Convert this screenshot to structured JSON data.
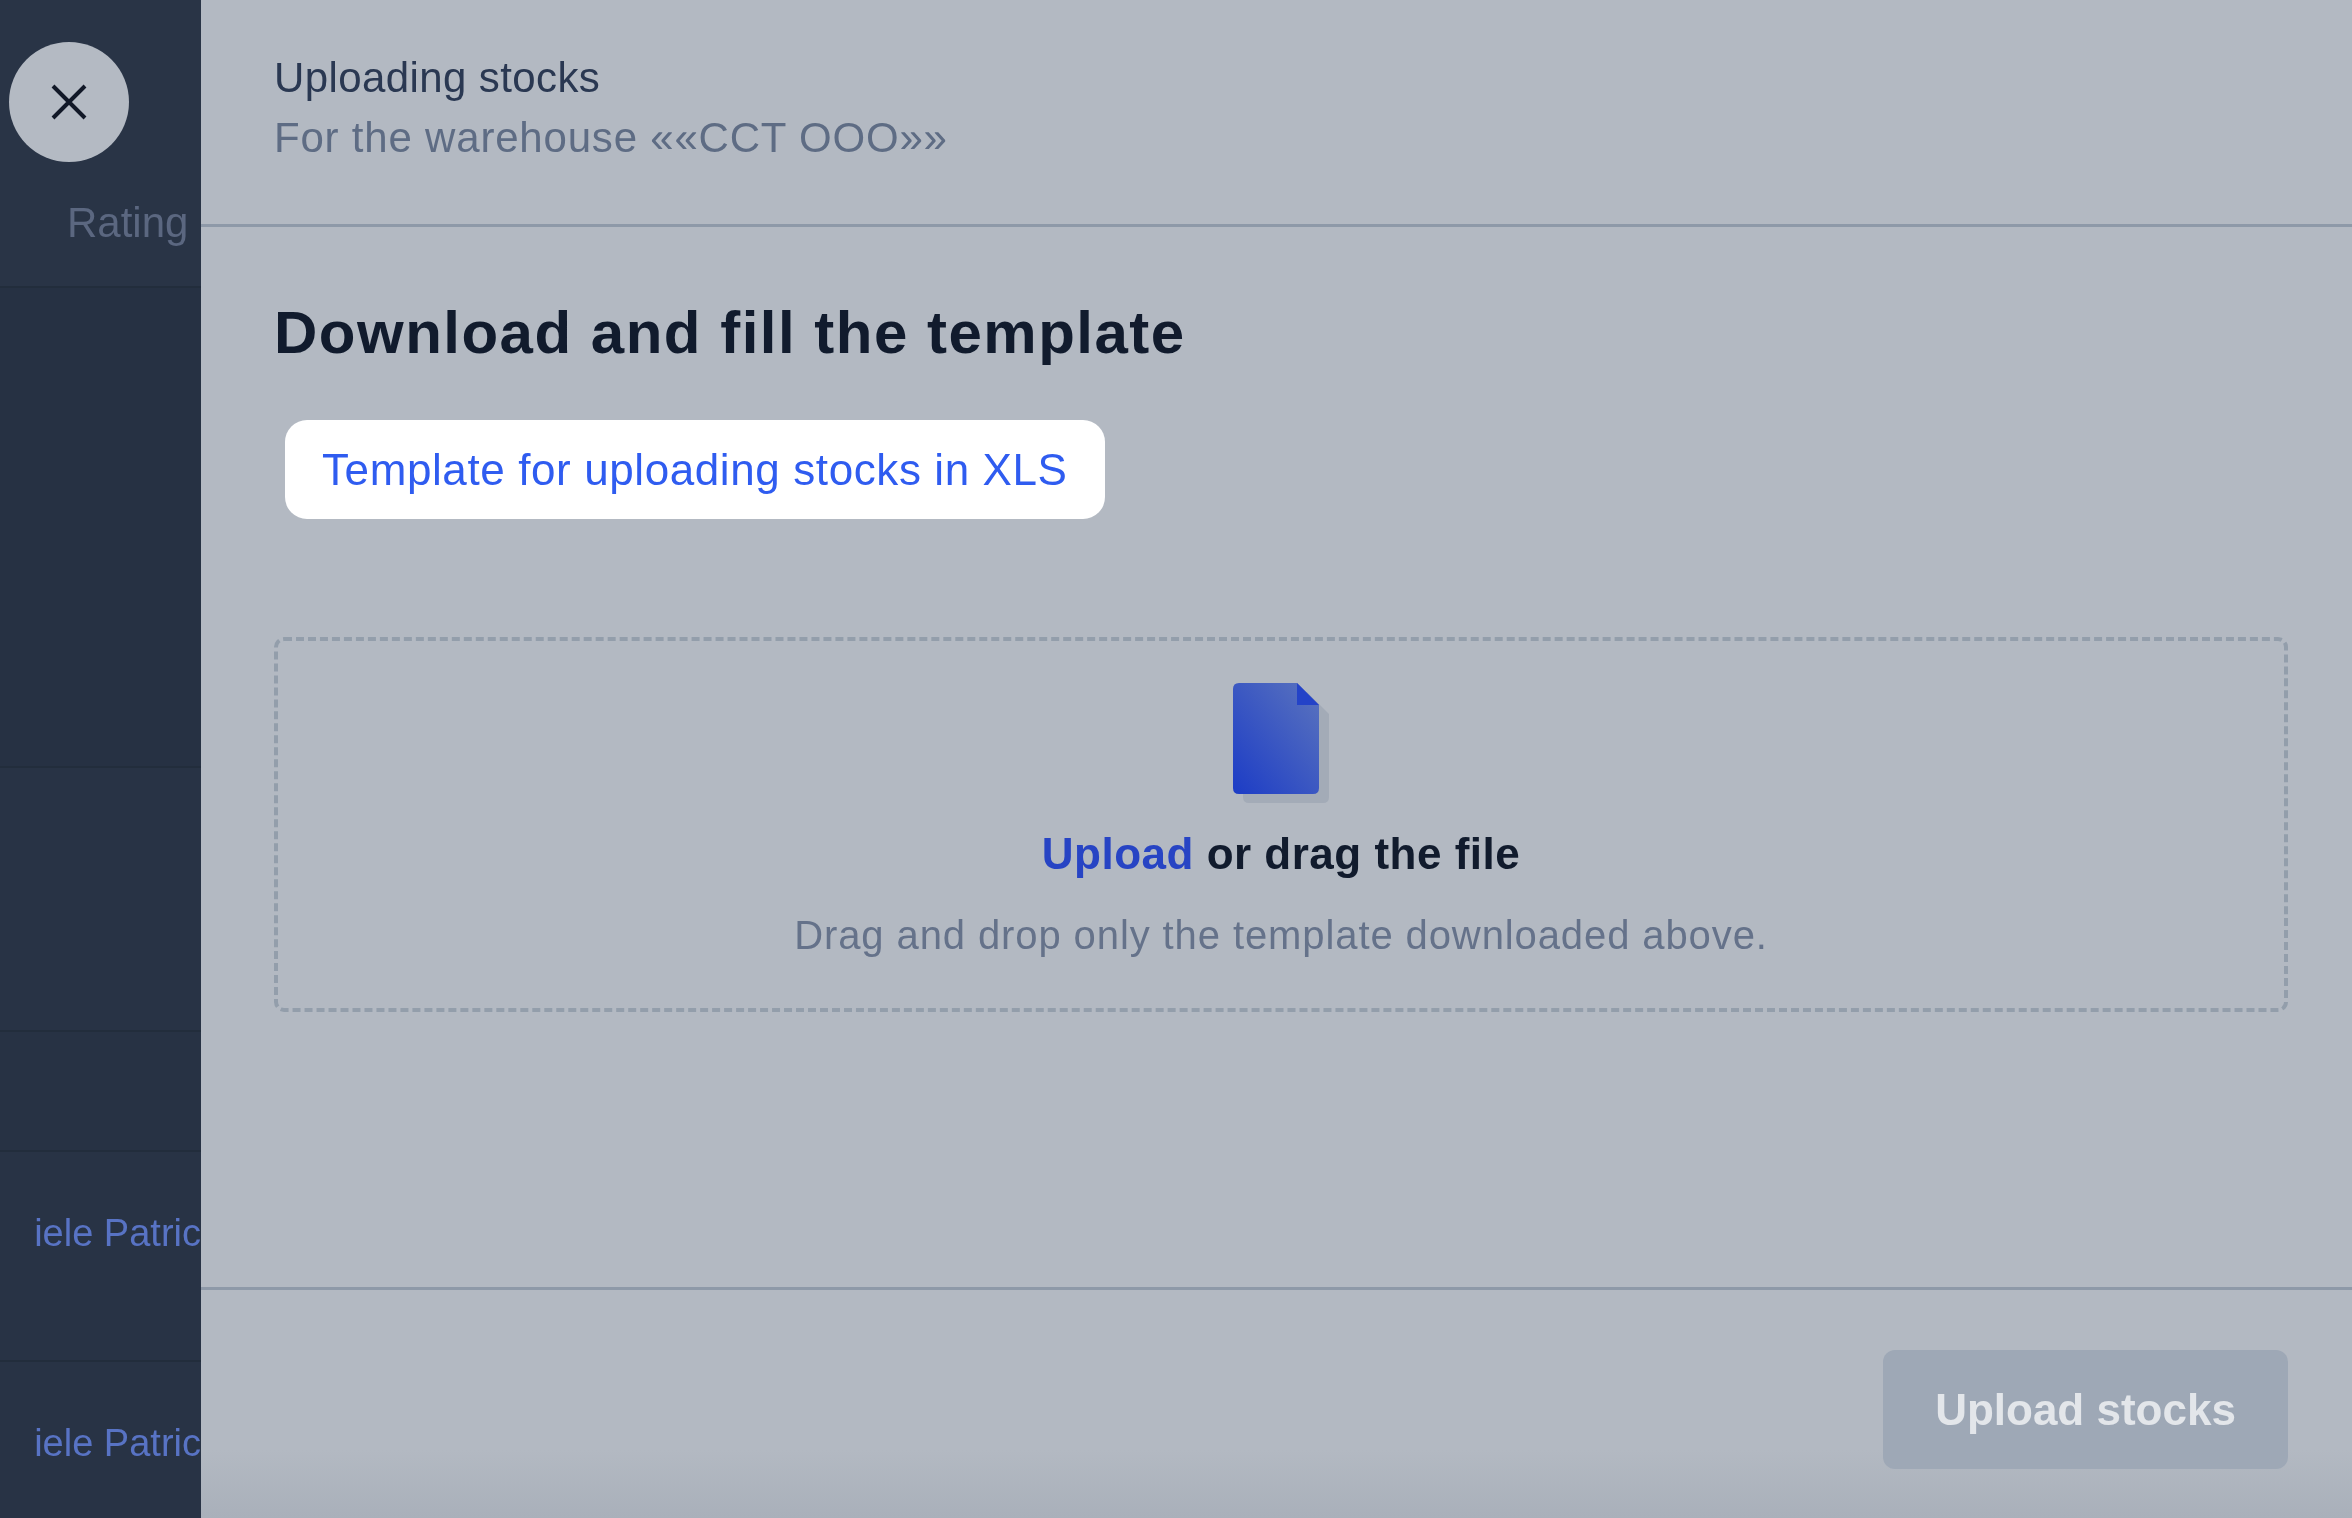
{
  "background_table": {
    "column_header": "Rating",
    "rows": [
      {
        "cell": "iele Patric"
      },
      {
        "cell": "iele Patric"
      }
    ]
  },
  "drawer": {
    "title": "Uploading stocks",
    "subtitle": "For the warehouse ««CCT OOO»»",
    "section_title": "Download and fill the template",
    "template_link": "Template for uploading stocks in XLS",
    "dropzone": {
      "link": "Upload",
      "text": "or drag the file",
      "hint": "Drag and drop only the template downloaded above."
    },
    "submit_button": {
      "label": "Upload stocks",
      "disabled": true
    }
  }
}
